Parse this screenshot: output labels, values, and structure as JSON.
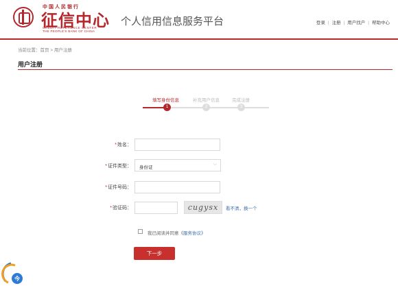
{
  "header": {
    "logo_small": "中国人民银行",
    "logo_main": "征信中心",
    "logo_en_line1": "CREDIT REFERENCE CENTER",
    "logo_en_line2": "THE PEOPLE'S BANK OF CHINA",
    "platform_title": "个人信用信息服务平台",
    "links": [
      "登录",
      "注册",
      "用户找户",
      "帮助中心"
    ]
  },
  "breadcrumb": "当前位置：首页 > 用户注册",
  "section_title": "用户注册",
  "steps": [
    {
      "label": "填写身份信息",
      "number": "1",
      "active": true
    },
    {
      "label": "补充用户信息",
      "number": "2",
      "active": false
    },
    {
      "label": "完成注册",
      "number": "3",
      "active": false
    }
  ],
  "form": {
    "name_label": "姓名：",
    "id_type_label": "证件类型：",
    "id_type_value": "身份证",
    "id_number_label": "证件号码：",
    "captcha_label": "验证码：",
    "captcha_text": "cugysx",
    "captcha_refresh": "看不清，换一个",
    "agree_prefix": "我已阅读并同意《",
    "agree_link": "服务协议",
    "agree_suffix": "》",
    "next_button": "下一步"
  },
  "colors": {
    "brand": "#b3282d",
    "link": "#3a6fb0"
  }
}
